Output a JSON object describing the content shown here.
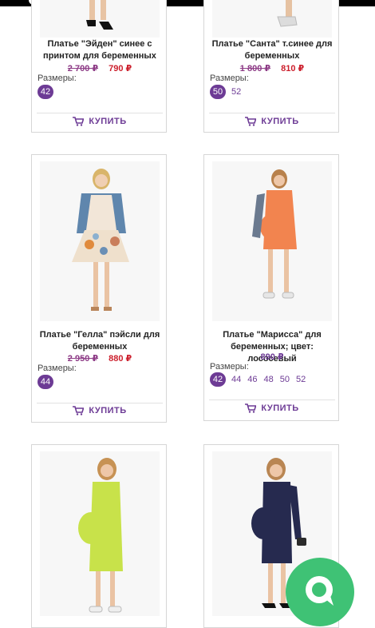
{
  "products": [
    {
      "title": "Платье \"Эйден\" синее с принтом для беременных",
      "old_price": "2 700 ₽",
      "price": "790 ₽",
      "sizes_label": "Размеры:",
      "sizes": [
        "42"
      ],
      "active_size": "42",
      "buy_label": "КУПИТЬ"
    },
    {
      "title": "Платье \"Санта\" т.синее для беременных",
      "old_price": "1 800 ₽",
      "price": "810 ₽",
      "sizes_label": "Размеры:",
      "sizes": [
        "50",
        "52"
      ],
      "active_size": "50",
      "buy_label": "КУПИТЬ"
    },
    {
      "title": "Платье \"Гелла\" пэйсли для беременных",
      "old_price": "2 950 ₽",
      "price": "880 ₽",
      "sizes_label": "Размеры:",
      "sizes": [
        "44"
      ],
      "active_size": "44",
      "buy_label": "КУПИТЬ"
    },
    {
      "title": "Платье \"Марисса\" для беременных; цвет: лососевый",
      "price": "890 ₽",
      "sizes_label": "Размеры:",
      "sizes": [
        "42",
        "44",
        "46",
        "48",
        "50",
        "52"
      ],
      "active_size": "42",
      "buy_label": "КУПИТЬ"
    },
    {
      "dress_color": "#c8e24a"
    },
    {
      "dress_color": "#262a4f"
    }
  ],
  "colors": {
    "accent": "#6d3b95",
    "sale_price": "#cc1f2c",
    "old_price": "#8d3b86",
    "chat_button": "#3fc275"
  },
  "icons": {
    "cart": "cart-icon",
    "chat": "chat-icon"
  }
}
